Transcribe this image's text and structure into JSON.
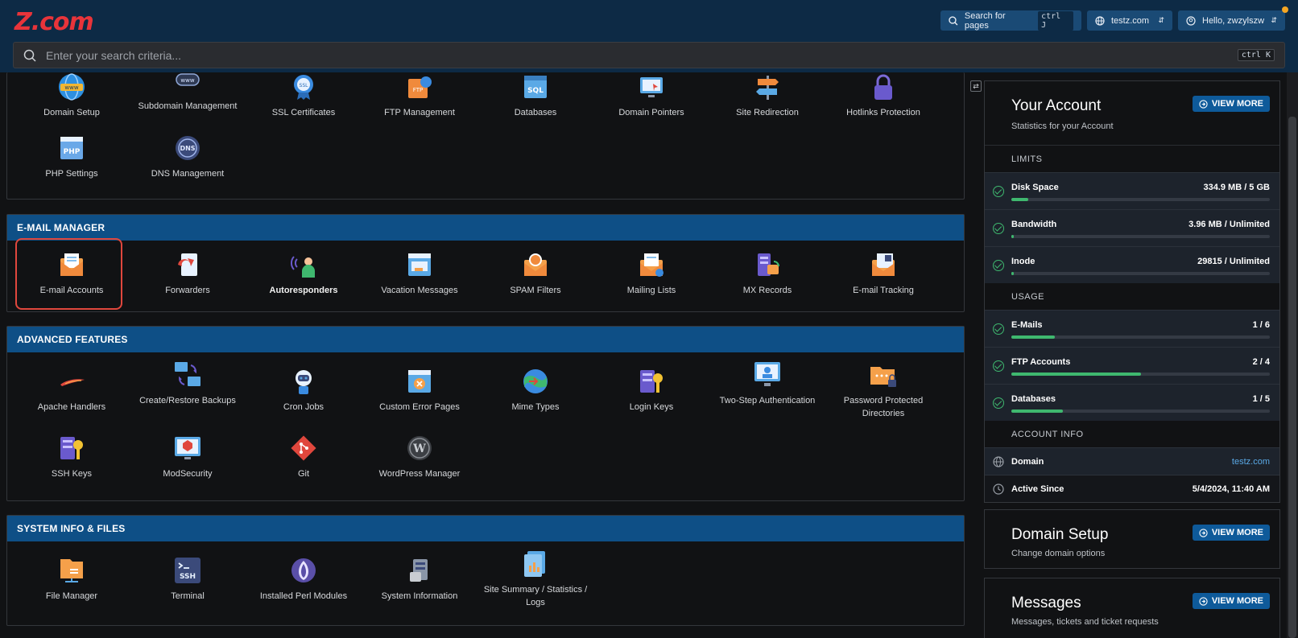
{
  "brand": {
    "logo": "Z.com"
  },
  "topbar": {
    "search_pages_label": "Search for pages",
    "search_pages_kbd": "ctrl J",
    "domain_label": "testz.com",
    "user_label": "Hello, zwzylszw"
  },
  "search": {
    "placeholder": "Enter your search criteria...",
    "kbd": "ctrl K"
  },
  "domain_section": {
    "tiles": [
      "Domain Setup",
      "Subdomain Management",
      "SSL Certificates",
      "FTP Management",
      "Databases",
      "Domain Pointers",
      "Site Redirection",
      "Hotlinks Protection",
      "PHP Settings",
      "DNS Management"
    ]
  },
  "email_section": {
    "title": "E-MAIL MANAGER",
    "tiles": [
      "E-mail Accounts",
      "Forwarders",
      "Autoresponders",
      "Vacation Messages",
      "SPAM Filters",
      "Mailing Lists",
      "MX Records",
      "E-mail Tracking"
    ]
  },
  "advanced_section": {
    "title": "ADVANCED FEATURES",
    "tiles": [
      "Apache Handlers",
      "Create/Restore Backups",
      "Cron Jobs",
      "Custom Error Pages",
      "Mime Types",
      "Login Keys",
      "Two-Step Authentication",
      "Password Protected Directories",
      "SSH Keys",
      "ModSecurity",
      "Git",
      "WordPress Manager"
    ]
  },
  "system_section": {
    "title": "SYSTEM INFO & FILES",
    "tiles": [
      "File Manager",
      "Terminal",
      "Installed Perl Modules",
      "System Information",
      "Site Summary / Statistics / Logs"
    ]
  },
  "account_card": {
    "title": "Your Account",
    "subtitle": "Statistics for your Account",
    "view_more": "VIEW MORE",
    "limits_label": "LIMITS",
    "limits": [
      {
        "name": "Disk Space",
        "value": "334.9 MB / 5 GB",
        "fill": 0.065
      },
      {
        "name": "Bandwidth",
        "value": "3.96 MB / Unlimited",
        "fill": 0.01
      },
      {
        "name": "Inode",
        "value": "29815 / Unlimited",
        "fill": 0.01
      }
    ],
    "usage_label": "USAGE",
    "usage": [
      {
        "name": "E-Mails",
        "value": "1 / 6",
        "fill": 0.1667
      },
      {
        "name": "FTP Accounts",
        "value": "2 / 4",
        "fill": 0.5
      },
      {
        "name": "Databases",
        "value": "1 / 5",
        "fill": 0.2
      }
    ],
    "info_label": "ACCOUNT INFO",
    "info": [
      {
        "name": "Domain",
        "value": "testz.com"
      },
      {
        "name": "Active Since",
        "value": "5/4/2024, 11:40 AM"
      }
    ]
  },
  "domain_card": {
    "title": "Domain Setup",
    "subtitle": "Change domain options",
    "view_more": "VIEW MORE"
  },
  "messages_card": {
    "title": "Messages",
    "subtitle": "Messages, tickets and ticket requests",
    "view_more": "VIEW MORE"
  },
  "colors": {
    "accent": "#0e4f86",
    "topbar": "#0d2a45",
    "highlight": "#e0473d",
    "success": "#3fb86f",
    "link": "#5aa9e6"
  }
}
